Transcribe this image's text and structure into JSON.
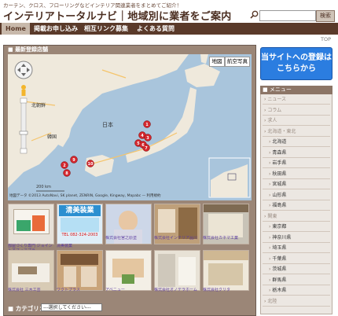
{
  "header": {
    "tagline": "カーテン、クロス、フローリングなどインテリア関連業者をまとめてご紹介！",
    "title": "インテリアトータルナビ｜地域別に業者をご案内",
    "search_button": "検索"
  },
  "nav": {
    "home": "Home",
    "apply": "掲載お申し込み",
    "links": "相互リンク募集",
    "faq": "よくある質問"
  },
  "top_link": "TOP",
  "main": {
    "panel_title": "最新登録店舗",
    "map": {
      "btn_map": "地図",
      "btn_satellite": "航空写真",
      "label_kita": "北朝鮮",
      "label_korea": "韓国",
      "label_japan": "日本",
      "scale": "200 km",
      "copyright": "地図データ ©2013 AutoNavi, SK planet, ZENRIN, Google, Kingway, Mapabc — 利用規約",
      "markers": [
        "1",
        "2",
        "3",
        "4",
        "5",
        "6",
        "7",
        "8",
        "9",
        "10"
      ]
    },
    "thumbs": [
      {
        "caption": "部屋づくり専門 ジョイントオフィスプラ",
        "banner": ""
      },
      {
        "caption": "清美装業",
        "banner": "清美装業",
        "phone": "TEL 082-324-2003"
      },
      {
        "caption": "株式会社宮之原塗",
        "banner": ""
      },
      {
        "caption": "株式会社インテリア品川",
        "banner": ""
      },
      {
        "caption": "株式会社カネマ工業",
        "banner": ""
      },
      {
        "caption": "株式会社 三木工芸",
        "banner": ""
      },
      {
        "caption": "ワクトプラス",
        "banner": ""
      },
      {
        "caption": "アベニュー",
        "banner": ""
      },
      {
        "caption": "株式会社オノデラホーム",
        "banner": ""
      },
      {
        "caption": "株式会社クリタ",
        "banner": ""
      }
    ],
    "category_label": "カテゴリ：",
    "category_select": "---選択してください---"
  },
  "sidebar": {
    "cta": "当サイトへの登録はこちらから",
    "menu_title": "メニュー",
    "items": [
      "ニュース",
      "コラム",
      "求人",
      "北海道・東北",
      "北海道",
      "青森県",
      "岩手県",
      "秋田県",
      "宮城県",
      "山形県",
      "福島県",
      "関東",
      "東京都",
      "神奈川県",
      "埼玉県",
      "千葉県",
      "茨城県",
      "群馬県",
      "栃木県",
      "北陸"
    ]
  },
  "colors": {
    "brown": "#5a3a2a",
    "panel": "#9b8677",
    "accent": "#2b7de0",
    "marker": "#d3262d"
  }
}
